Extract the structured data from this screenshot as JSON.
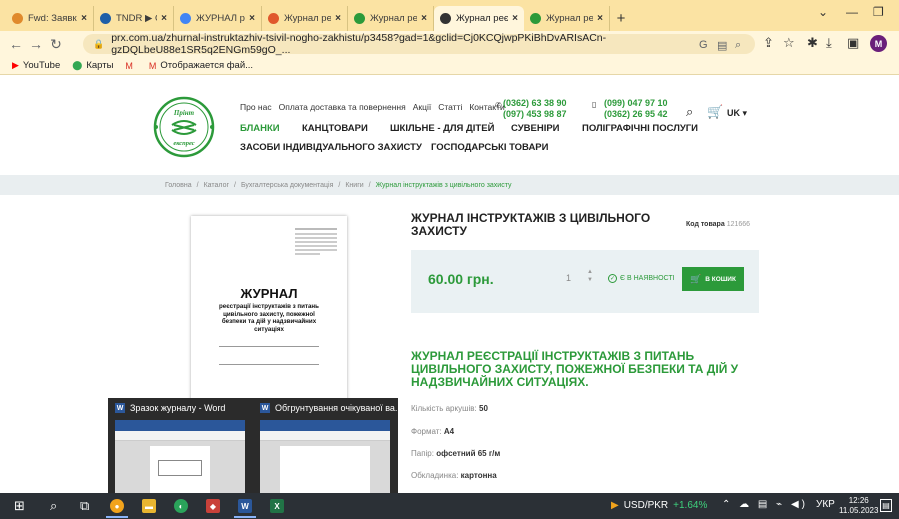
{
  "browser": {
    "tabs": [
      {
        "label": "Fwd: Заявка Жур",
        "icon_color": "#e08a2c",
        "icon": "gmail-icon"
      },
      {
        "label": "TNDR ▶ Освіти",
        "icon_color": "#1f5fa8",
        "icon": "tndr-icon"
      },
      {
        "label": "ЖУРНАЛ реєстра",
        "icon_color": "#4285f4",
        "icon": "google-icon"
      },
      {
        "label": "Журнал реєстр",
        "icon_color": "#e0582c",
        "icon": "play-icon"
      },
      {
        "label": "Журнал реєстра",
        "icon_color": "#2c9a3a",
        "icon": "site-icon"
      },
      {
        "label": "Журнал реєстра",
        "icon_color": "#333333",
        "icon": "chrome-icon",
        "active": true
      },
      {
        "label": "Журнал реєстра",
        "icon_color": "#2c9a3a",
        "icon": "site-icon"
      }
    ],
    "url": "prx.com.ua/zhurnal-instruktazhiv-tsivil-nogho-zakhistu/p3458?gad=1&gclid=Cj0KCQjwpPKiBhDvARIsACn-gzDQLbeU88e1SR5q2ENGm59gO_...",
    "avatar_letter": "M",
    "bookmarks": [
      {
        "label": "YouTube",
        "icon": "youtube-icon",
        "color": "#ff0000"
      },
      {
        "label": "Карты",
        "icon": "maps-pin-icon",
        "color": "#34a853"
      },
      {
        "label": "",
        "icon": "gmail-icon",
        "color": "#d93025"
      },
      {
        "label": "Отображается фай...",
        "icon": "gmail-icon",
        "color": "#d93025"
      }
    ]
  },
  "site": {
    "logo_text_top": "Прінт",
    "logo_text_bottom": "експрес",
    "topnav": [
      "Про нас",
      "Оплата доставка та повернення",
      "Акції",
      "Статті",
      "Контакти"
    ],
    "phones_col1": [
      "(0362) 63 38 90",
      "(097) 453 98 87"
    ],
    "phones_col2": [
      "(099) 047 97 10",
      "(0362) 26 95 42"
    ],
    "lang": "UK",
    "mainnav": [
      "БЛАНКИ",
      "КАНЦТОВАРИ",
      "ШКІЛЬНЕ - ДЛЯ ДІТЕЙ",
      "СУВЕНІРИ",
      "ПОЛІГРАФІЧНІ ПОСЛУГИ",
      "ЗАСОБИ ІНДИВІДУАЛЬНОГО ЗАХИСТУ",
      "ГОСПОДАРСЬКІ ТОВАРИ"
    ],
    "breadcrumb": [
      "Головна",
      "Каталог",
      "Бухгалтерська документація",
      "Книги",
      "Журнал інструктажів з цивільного захисту"
    ],
    "accent": "#2c9a3a"
  },
  "product": {
    "title": "ЖУРНАЛ ІНСТРУКТАЖІВ З ЦИВІЛЬНОГО ЗАХИСТУ",
    "code_label": "Код товара",
    "code": "121666",
    "price": "60.00 грн.",
    "qty": "1",
    "stock": "Є В НАЯВНОСТІ",
    "cart_label": "В КОШИК",
    "cover_title": "ЖУРНАЛ",
    "cover_subtitle": "реєстрації інструктажів з питань цивільного захисту, пожежної безпеки та дій у надзвичайних ситуаціях",
    "description_title": "ЖУРНАЛ РЕЄСТРАЦІЇ ІНСТРУКТАЖІВ З ПИТАНЬ ЦИВІЛЬНОГО ЗАХИСТУ, ПОЖЕЖНОЇ БЕЗПЕКИ ТА ДІЙ У НАДЗВИЧАЙНИХ СИТУАЦІЯХ.",
    "specs": [
      {
        "label": "Кількість аркушів:",
        "value": "50"
      },
      {
        "label": "Формат:",
        "value": "А4"
      },
      {
        "label": "Папір:",
        "value": "офсетний 65 г/м"
      },
      {
        "label": "Обкладинка:",
        "value": "картонна"
      }
    ]
  },
  "taskbar_preview": [
    {
      "label": "Зразок журналу - Word"
    },
    {
      "label": "Обгрунтування очікуваної ва..."
    }
  ],
  "taskbar": {
    "ticker_label": "USD/PKR",
    "ticker_change": "+1.64%",
    "lang": "УКР",
    "time": "12:26",
    "date": "11.05.2023"
  }
}
